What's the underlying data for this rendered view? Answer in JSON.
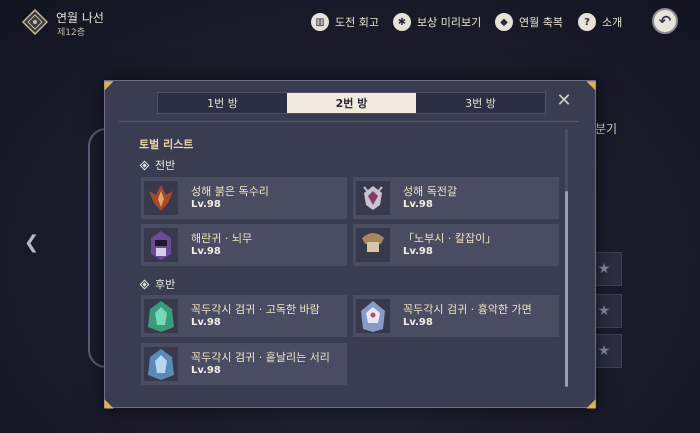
{
  "header": {
    "title": "연월 나선",
    "subtitle": "제12층"
  },
  "nav": {
    "challenge_review": "도전 회고",
    "reward_preview": "보상 미리보기",
    "celebration": "연월 축복",
    "intro": "소개"
  },
  "background": {
    "right_label": "분기"
  },
  "modal": {
    "tabs": [
      "1번 방",
      "2번 방",
      "3번 방"
    ],
    "active_tab": 1,
    "list_title": "토벌 리스트",
    "first_half": {
      "label": "전반",
      "enemies": [
        {
          "name": "성해 붉은 독수리",
          "level": "Lv.98",
          "icon": "red-eagle-portrait"
        },
        {
          "name": "성해 독전갈",
          "level": "Lv.98",
          "icon": "scorpion-portrait"
        },
        {
          "name": "해란귀 · 뇌무",
          "level": "Lv.98",
          "icon": "purple-ghost-portrait"
        },
        {
          "name": "「노부시 · 칼잡이」",
          "level": "Lv.98",
          "icon": "nobushi-portrait"
        }
      ]
    },
    "second_half": {
      "label": "후반",
      "enemies": [
        {
          "name": "꼭두각시 검귀 · 고독한 바람",
          "level": "Lv.98",
          "icon": "green-automaton-portrait"
        },
        {
          "name": "꼭두각시 검귀 · 흉악한 가면",
          "level": "Lv.98",
          "icon": "masked-automaton-portrait"
        },
        {
          "name": "꼭두각시 검귀 · 흩날리는 서리",
          "level": "Lv.98",
          "icon": "frost-automaton-portrait"
        }
      ]
    }
  },
  "colors": {
    "modal_bg": "#3a3c50",
    "card_bg": "#4a4c62",
    "active_tab": "#efeadb",
    "accent_gold": "#d8b35a"
  }
}
